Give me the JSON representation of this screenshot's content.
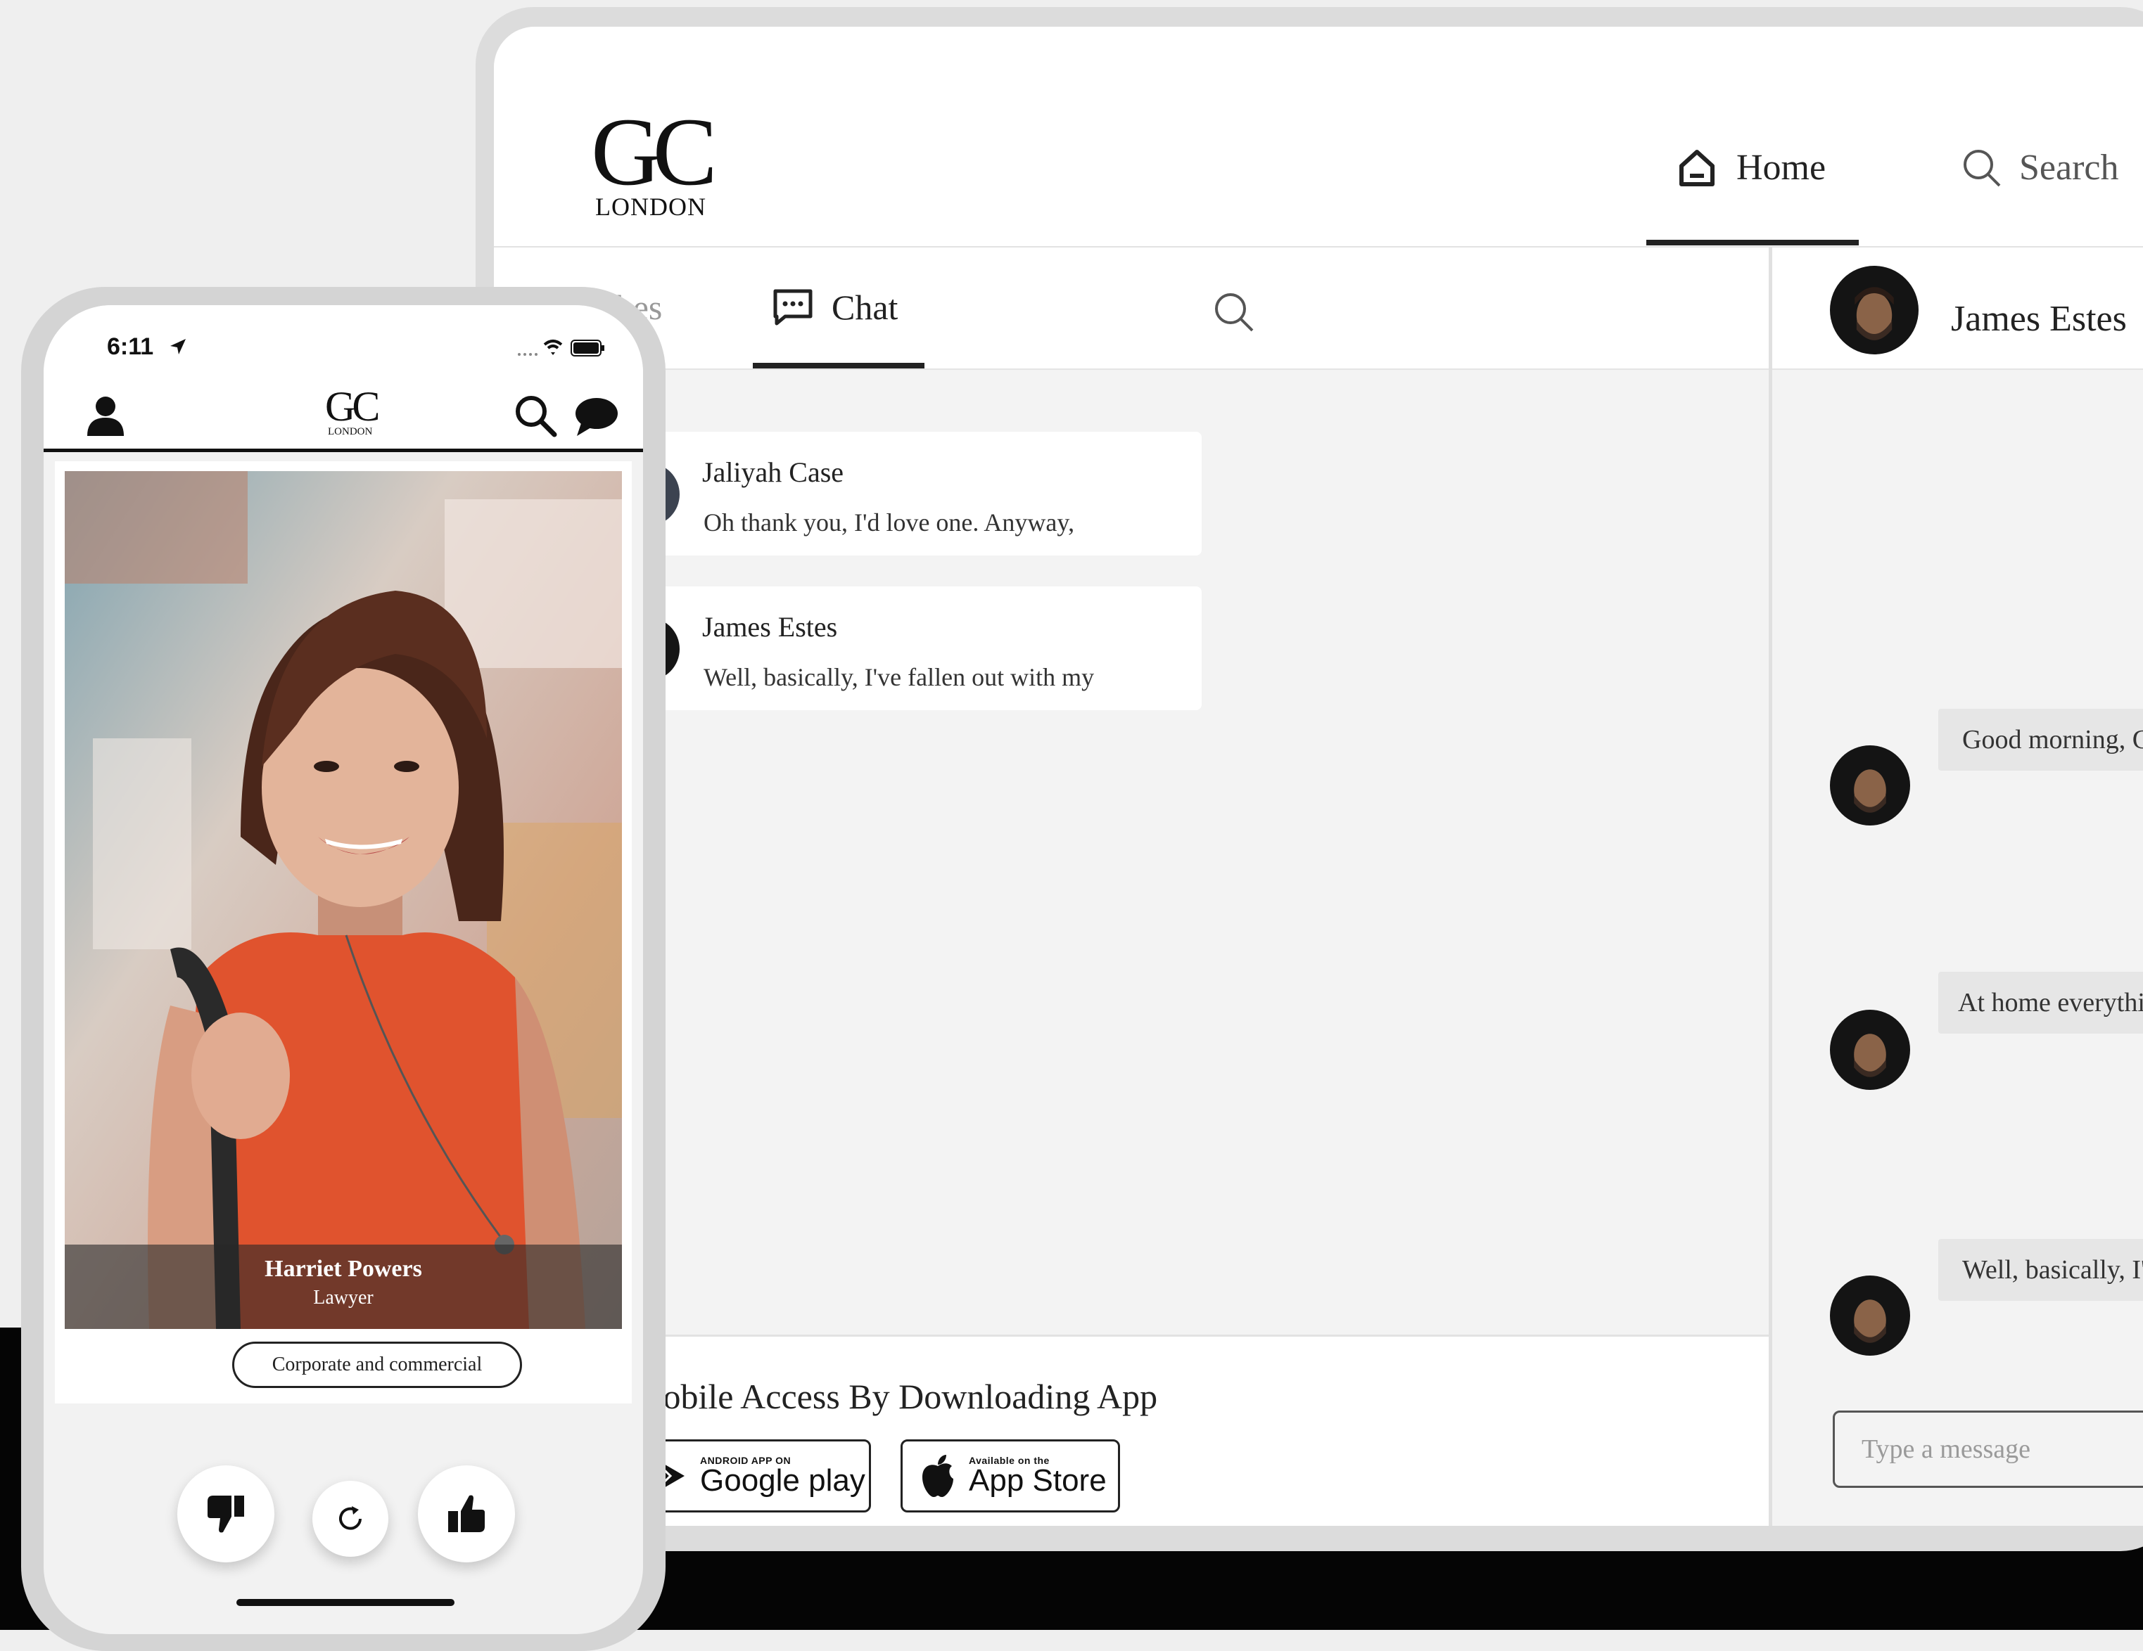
{
  "web": {
    "logo": {
      "main": "GC",
      "sub": "LONDON"
    },
    "nav": {
      "home": "Home",
      "search": "Search"
    },
    "tabs": {
      "matches": "Matches",
      "chat": "Chat"
    },
    "conversations": [
      {
        "name": "Jaliyah Case",
        "preview": "Oh thank you, I'd love one. Anyway,"
      },
      {
        "name": "James Estes",
        "preview": "Well, basically, I've fallen out with my"
      }
    ],
    "download": {
      "title": "Mobile Access By Downloading App",
      "google_small": "ANDROID APP ON",
      "google_big": "Google play",
      "apple_small": "Available on the",
      "apple_big": "App Store"
    },
    "chat": {
      "contact": "James Estes",
      "messages": [
        "Good morning, Gary.",
        "At home everything's fine but in the office it's all upside down",
        "Well, basically, I've fallen out with my partners."
      ],
      "input_placeholder": "Type a message"
    }
  },
  "phone": {
    "status": {
      "time": "6:11"
    },
    "logo": {
      "main": "GC",
      "sub": "LONDON"
    },
    "profile": {
      "name": "Harriet Powers",
      "role": "Lawyer",
      "tag": "Corporate and commercial"
    },
    "icons": [
      "user-icon",
      "search-icon",
      "chat-bubble-icon",
      "thumbs-down-icon",
      "refresh-icon",
      "thumbs-up-icon"
    ]
  }
}
